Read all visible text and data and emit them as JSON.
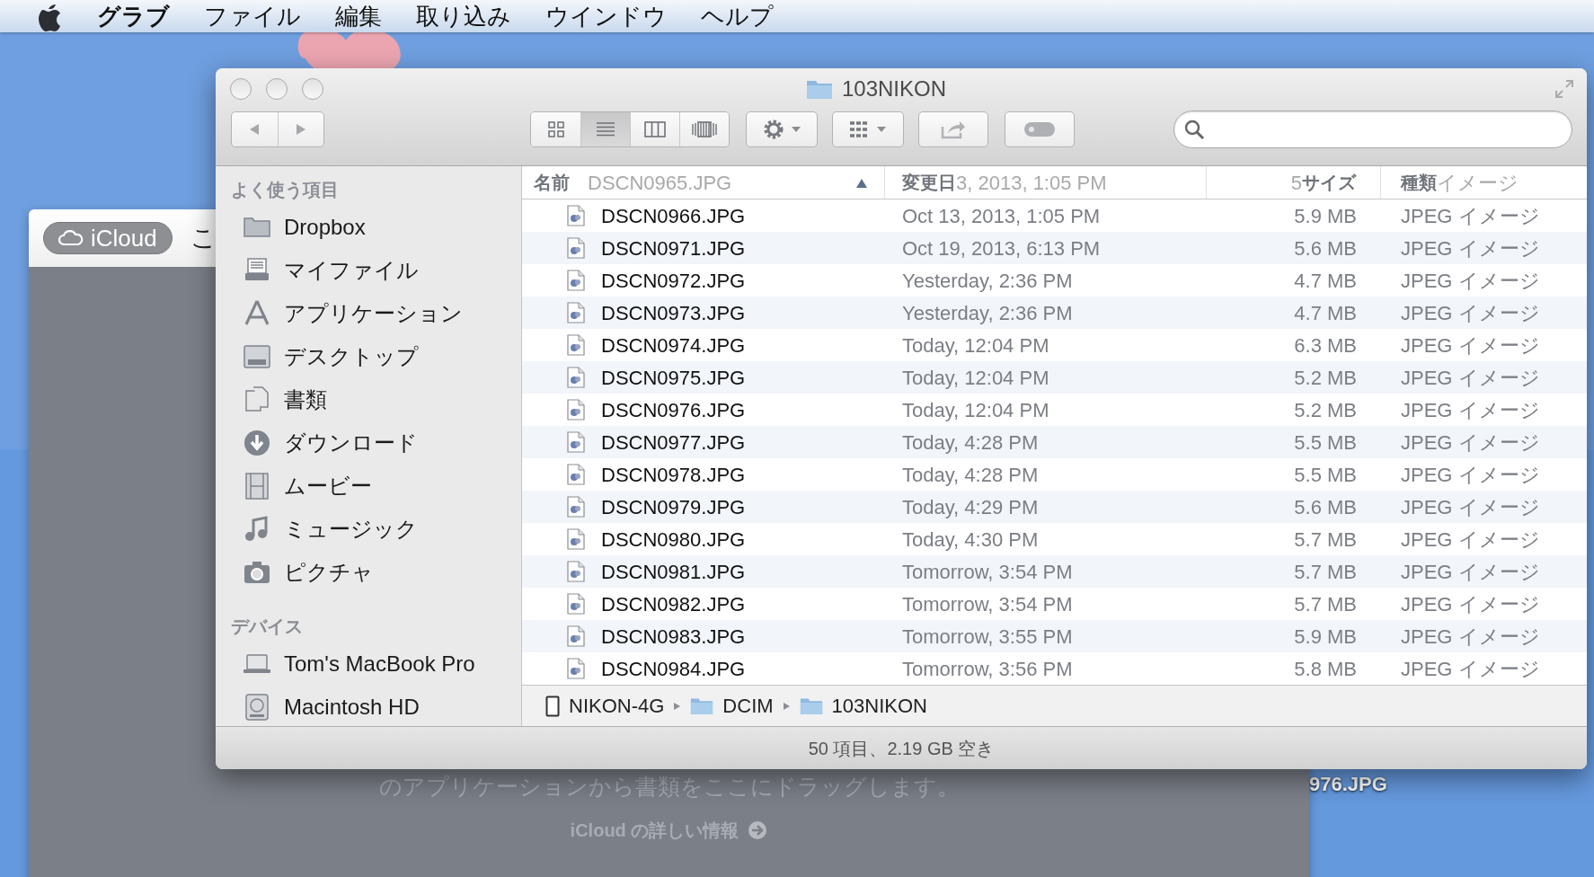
{
  "menu_bar": {
    "app_name": "グラブ",
    "menus": [
      "ファイル",
      "編集",
      "取り込み",
      "ウインドウ",
      "ヘルプ"
    ]
  },
  "background_window": {
    "cloud_button": "iCloud",
    "title_fragment": "こ",
    "message": "のアプリケーションから書類をここにドラッグします。",
    "link": "iCloud の詳しい情報"
  },
  "desktop_label": "976.JPG",
  "finder": {
    "title": "103NIKON",
    "view_modes": [
      {
        "kind": "icons",
        "selected": false
      },
      {
        "kind": "list",
        "selected": true
      },
      {
        "kind": "columns",
        "selected": false
      },
      {
        "kind": "coverflow",
        "selected": false
      }
    ],
    "sidebar": [
      {
        "heading": "よく使う項目",
        "items": [
          {
            "label": "Dropbox",
            "kind": "folder"
          },
          {
            "label": "マイファイル",
            "kind": "files"
          },
          {
            "label": "アプリケーション",
            "kind": "apps"
          },
          {
            "label": "デスクトップ",
            "kind": "desktop"
          },
          {
            "label": "書類",
            "kind": "documents"
          },
          {
            "label": "ダウンロード",
            "kind": "download"
          },
          {
            "label": "ムービー",
            "kind": "movie"
          },
          {
            "label": "ミュージック",
            "kind": "music"
          },
          {
            "label": "ピクチャ",
            "kind": "camera"
          }
        ]
      },
      {
        "heading": "デバイス",
        "items": [
          {
            "label": "Tom's MacBook Pro",
            "kind": "laptop"
          },
          {
            "label": "Macintosh HD",
            "kind": "disk"
          }
        ]
      }
    ],
    "columns": [
      {
        "label": "名前",
        "sorted": true
      },
      {
        "label": "変更日",
        "sorted": false
      },
      {
        "label": "サイズ",
        "sorted": false
      },
      {
        "label": "種類",
        "sorted": false
      }
    ],
    "ghost_row": {
      "name": "DSCN0965.JPG",
      "date": "3, 2013, 1:05 PM",
      "size": "5",
      "kind": "イメージ"
    },
    "rows": [
      {
        "name": "DSCN0966.JPG",
        "date": "Oct 13, 2013, 1:05 PM",
        "size": "5.9 MB",
        "kind": "JPEG イメージ"
      },
      {
        "name": "DSCN0971.JPG",
        "date": "Oct 19, 2013, 6:13 PM",
        "size": "5.6 MB",
        "kind": "JPEG イメージ"
      },
      {
        "name": "DSCN0972.JPG",
        "date": "Yesterday, 2:36 PM",
        "size": "4.7 MB",
        "kind": "JPEG イメージ"
      },
      {
        "name": "DSCN0973.JPG",
        "date": "Yesterday, 2:36 PM",
        "size": "4.7 MB",
        "kind": "JPEG イメージ"
      },
      {
        "name": "DSCN0974.JPG",
        "date": "Today, 12:04 PM",
        "size": "6.3 MB",
        "kind": "JPEG イメージ"
      },
      {
        "name": "DSCN0975.JPG",
        "date": "Today, 12:04 PM",
        "size": "5.2 MB",
        "kind": "JPEG イメージ"
      },
      {
        "name": "DSCN0976.JPG",
        "date": "Today, 12:04 PM",
        "size": "5.2 MB",
        "kind": "JPEG イメージ"
      },
      {
        "name": "DSCN0977.JPG",
        "date": "Today, 4:28 PM",
        "size": "5.5 MB",
        "kind": "JPEG イメージ"
      },
      {
        "name": "DSCN0978.JPG",
        "date": "Today, 4:28 PM",
        "size": "5.5 MB",
        "kind": "JPEG イメージ"
      },
      {
        "name": "DSCN0979.JPG",
        "date": "Today, 4:29 PM",
        "size": "5.6 MB",
        "kind": "JPEG イメージ"
      },
      {
        "name": "DSCN0980.JPG",
        "date": "Today, 4:30 PM",
        "size": "5.7 MB",
        "kind": "JPEG イメージ"
      },
      {
        "name": "DSCN0981.JPG",
        "date": "Tomorrow, 3:54 PM",
        "size": "5.7 MB",
        "kind": "JPEG イメージ"
      },
      {
        "name": "DSCN0982.JPG",
        "date": "Tomorrow, 3:54 PM",
        "size": "5.7 MB",
        "kind": "JPEG イメージ"
      },
      {
        "name": "DSCN0983.JPG",
        "date": "Tomorrow, 3:55 PM",
        "size": "5.9 MB",
        "kind": "JPEG イメージ"
      },
      {
        "name": "DSCN0984.JPG",
        "date": "Tomorrow, 3:56 PM",
        "size": "5.8 MB",
        "kind": "JPEG イメージ"
      }
    ],
    "path": [
      {
        "label": "NIKON-4G",
        "kind": "card"
      },
      {
        "label": "DCIM",
        "kind": "folder"
      },
      {
        "label": "103NIKON",
        "kind": "folder"
      }
    ],
    "status": "50 項目、2.19 GB 空き"
  }
}
